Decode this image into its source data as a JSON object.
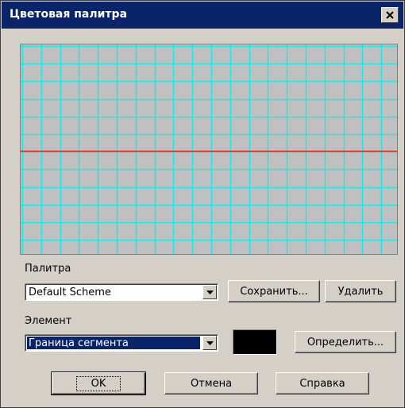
{
  "window": {
    "title": "Цветовая палитра"
  },
  "palette": {
    "background_color": "#c0c0c0",
    "grid_color": "#1fe6e6",
    "marker_color": "#e61e1e"
  },
  "palette_section": {
    "label": "Палитра",
    "selected_value": "Default Scheme",
    "save_label": "Сохранить...",
    "delete_label": "Удалить"
  },
  "element_section": {
    "label": "Элемент",
    "selected_value": "Граница сегмента",
    "define_label": "Определить...",
    "swatch_color": "#000000"
  },
  "footer": {
    "ok_label": "OK",
    "cancel_label": "Отмена",
    "help_label": "Справка"
  },
  "icons": {
    "close": "close-icon",
    "dropdown": "chevron-down-icon"
  }
}
